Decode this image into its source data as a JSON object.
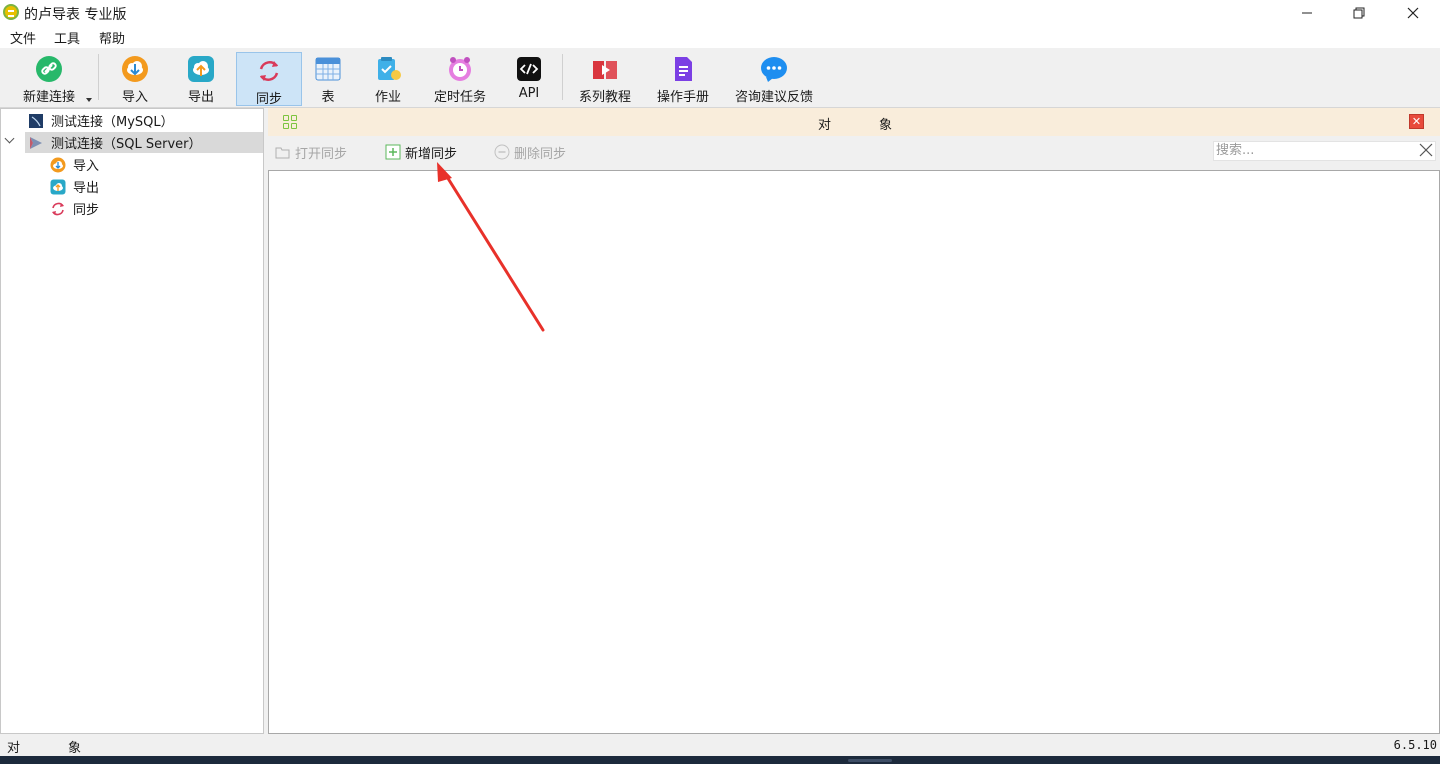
{
  "window": {
    "title": "的卢导表 专业版"
  },
  "menu": [
    "文件",
    "工具",
    "帮助"
  ],
  "toolbar": {
    "new_connection": "新建连接",
    "import": "导入",
    "export": "导出",
    "sync": "同步",
    "table": "表",
    "job": "作业",
    "scheduled_task": "定时任务",
    "api": "API",
    "tutorials": "系列教程",
    "manual": "操作手册",
    "feedback": "咨询建议反馈"
  },
  "tree": {
    "conn_mysql": "测试连接（MySQL）",
    "conn_sqlserver": "测试连接（SQL Server）",
    "child_import": "导入",
    "child_export": "导出",
    "child_sync": "同步"
  },
  "objects_panel": {
    "title": "对象",
    "open_sync": "打开同步",
    "new_sync": "新增同步",
    "delete_sync": "删除同步",
    "search_placeholder": "搜索..."
  },
  "statusbar": {
    "left": "对象",
    "version": "6.5.10"
  },
  "colors": {
    "active_toolbar": "#cde4f7",
    "objects_header": "#f9eddb",
    "annotation_arrow": "#e8312a"
  }
}
